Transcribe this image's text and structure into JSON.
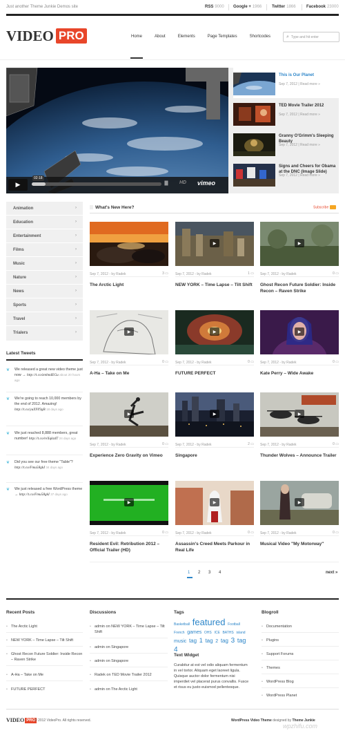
{
  "topbar": {
    "tagline": "Just another Theme Junkie Demos site",
    "social": [
      {
        "name": "RSS",
        "count": "9000"
      },
      {
        "name": "Google +",
        "count": "1966"
      },
      {
        "name": "Twitter",
        "count": "1866"
      },
      {
        "name": "Facebook",
        "count": "23000"
      }
    ]
  },
  "header": {
    "logo_video": "VIDEO",
    "logo_pro": "PRO",
    "nav": [
      "Home",
      "About",
      "Elements",
      "Page Templates",
      "Shortcodes"
    ],
    "search_placeholder": "Type and hit enter"
  },
  "player": {
    "time": "02:18",
    "hd": "HD",
    "brand": "vimeo"
  },
  "featured_list": [
    {
      "title": "This is Our Planet",
      "meta": "Sep 7, 2012 | Read more »"
    },
    {
      "title": "TED Movie Trailer 2012",
      "meta": "Sep 7, 2012 | Read more »"
    },
    {
      "title": "Granny O'Grimm's Sleeping Beauty",
      "meta": "Sep 7, 2012 | Read more »"
    },
    {
      "title": "Signs and Cheers for Obama at the DNC (Image Slide)",
      "meta": "Sep 7, 2012 | Read more »"
    }
  ],
  "categories": [
    "Animation",
    "Education",
    "Entertainment",
    "Films",
    "Music",
    "Nature",
    "News",
    "Sports",
    "Travel",
    "Trialers"
  ],
  "tweets": {
    "title": "Latest Tweets",
    "items": [
      {
        "text": "We released a great new video theme just now → ",
        "link": "http://t.co/zmhndEGu",
        "time": "about 20 hours ago"
      },
      {
        "text": "We're going to reach 10,000 members by the end of 2012. Amazing! ",
        "link": "http://t.co/yuX9Y9gB",
        "time": "18 days ago"
      },
      {
        "text": "We just reached 8,888 members, great number! ",
        "link": "http://t.co/reXqkzdT",
        "time": "24 days ago"
      },
      {
        "text": "Did you see our free theme \"Table\"? ",
        "link": "http://t.co/Fmu58gkI",
        "time": "34 days ago"
      },
      {
        "text": "We just released a free WordPress theme → ",
        "link": "http://t.co/Fmu58gkI",
        "time": "37 days ago"
      }
    ]
  },
  "main": {
    "title": "What's New Here?",
    "subscribe": "Subscribe",
    "cards": [
      {
        "title": "The Arctic Light",
        "meta": "Sep 7, 2012 - by Radek",
        "comments": "3"
      },
      {
        "title": "NEW YORK – Time Lapse – Tilt Shift",
        "meta": "Sep 7, 2012 - by Radek",
        "comments": "1"
      },
      {
        "title": "Ghost Recon Future Soldier: Inside Recon – Raven Strike",
        "meta": "Sep 7, 2012 - by Radek",
        "comments": "0"
      },
      {
        "title": "A-Ha – Take on Me",
        "meta": "Sep 7, 2012 - by Radek",
        "comments": "0"
      },
      {
        "title": "FUTURE PERFECT",
        "meta": "Sep 7, 2012 - by Radek",
        "comments": "0"
      },
      {
        "title": "Kate Perry – Wide Awake",
        "meta": "Sep 7, 2012 - by Radek",
        "comments": "0"
      },
      {
        "title": "Experience Zero Gravity on Vimeo",
        "meta": "Sep 7, 2012 - by Radek",
        "comments": "0"
      },
      {
        "title": "Singapore",
        "meta": "Sep 7, 2012 - by Radek",
        "comments": "2"
      },
      {
        "title": "Thunder Wolves – Announce Trailer",
        "meta": "Sep 7, 2012 - by Radek",
        "comments": "0"
      },
      {
        "title": "Resident Evil: Retribution 2012 – Official Trailer (HD)",
        "meta": "Sep 7, 2012 - by Radek",
        "comments": "0"
      },
      {
        "title": "Assassin's Creed Meets Parkour in Real Life",
        "meta": "Sep 7, 2012 - by Radek",
        "comments": "0"
      },
      {
        "title": "Musical Video \"My Motorway\"",
        "meta": "Sep 7, 2012 - by Radek",
        "comments": "0"
      }
    ],
    "pages": [
      "1",
      "2",
      "3",
      "4"
    ],
    "next": "next »"
  },
  "footer": {
    "recent_title": "Recent Posts",
    "recent": [
      "The Arctic Light",
      "NEW YORK – Time Lapse – Tilt Shift",
      "Ghost Recon Future Soldier: Inside Recon – Raven Strike",
      "A-Ha – Take on Me",
      "FUTURE PERFECT"
    ],
    "discussions_title": "Discussions",
    "discussions": [
      "admin on NEW YORK – Time Lapse – Tilt Shift",
      "admin on Singapore",
      "admin on Singapore",
      "Radek on TED Movie Trailer 2012",
      "admin on The Arctic Light"
    ],
    "tags_title": "Tags",
    "tags": [
      {
        "t": "Basketball",
        "s": 5
      },
      {
        "t": "featured",
        "s": 13
      },
      {
        "t": "Football",
        "s": 5
      },
      {
        "t": "French",
        "s": 5
      },
      {
        "t": "games",
        "s": 7
      },
      {
        "t": "OHS",
        "s": 5
      },
      {
        "t": "ICE",
        "s": 5
      },
      {
        "t": "BATHS",
        "s": 5
      },
      {
        "t": "island",
        "s": 5
      },
      {
        "t": "music",
        "s": 7
      },
      {
        "t": "tag",
        "s": 8
      },
      {
        "t": "1",
        "s": 9
      },
      {
        "t": "tag",
        "s": 8
      },
      {
        "t": "2",
        "s": 7
      },
      {
        "t": "tag",
        "s": 8
      },
      {
        "t": "3",
        "s": 10
      },
      {
        "t": "tag",
        "s": 9
      },
      {
        "t": "4",
        "s": 10
      }
    ],
    "text_widget_title": "Text Widget",
    "text_widget": "Curabitur at est vel odio aliquam fermentum in vel tortor. Aliquam eget laoreet ligula. Quisque auctor dolor fermentum nisi imperdiet vel placerat purus convallis. Fusce et risus eu justo euismod pellentesque.",
    "blogroll_title": "Blogroll",
    "blogroll": [
      "Documentation",
      "Plugins",
      "Support Forums",
      "Themes",
      "WordPress Blog",
      "WordPress Planet"
    ],
    "logo_video": "VIDEO",
    "logo_pro": "PRO",
    "copyright": "© 2012 VideoPro. All rights reserved.",
    "credits_a": "WordPress Video Theme",
    "credits_b": " designed by ",
    "credits_c": "Theme Junkie",
    "watermark": "wpzhifu.com"
  }
}
